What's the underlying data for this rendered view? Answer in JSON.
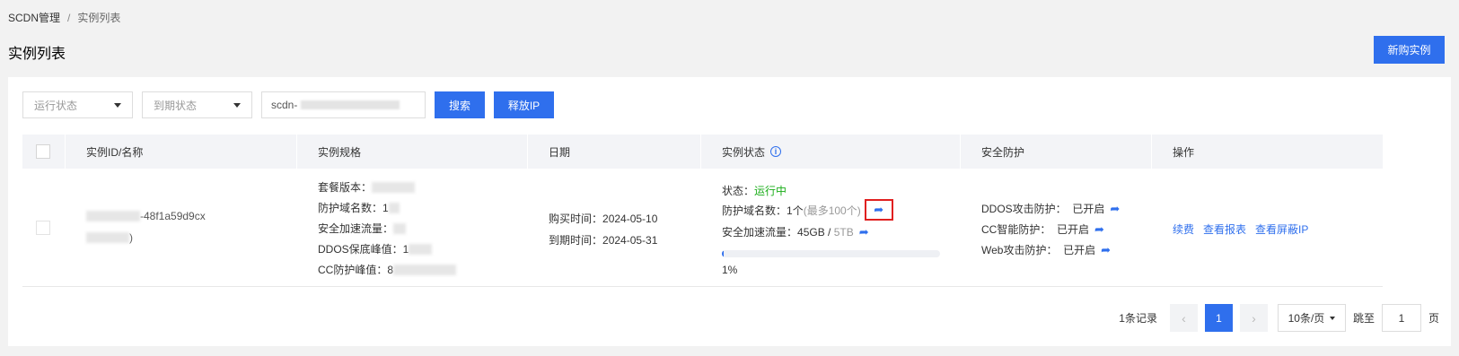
{
  "breadcrumb": {
    "root": "SCDN管理",
    "separator": "/",
    "current": "实例列表"
  },
  "page": {
    "title": "实例列表",
    "buy_button": "新购实例"
  },
  "filters": {
    "run_status_placeholder": "运行状态",
    "expire_status_placeholder": "到期状态",
    "search_value_prefix": "scdn-",
    "search_button": "搜索",
    "release_button": "释放IP"
  },
  "table": {
    "headers": {
      "id": "实例ID/名称",
      "spec": "实例规格",
      "date": "日期",
      "status": "实例状态",
      "security": "安全防护",
      "ops": "操作"
    },
    "rows": [
      {
        "id_suffix": "-48f1a59d9cx",
        "name_suffix": ")",
        "spec": {
          "package": "套餐版本：",
          "domains": "防护域名数：1",
          "traffic": "安全加速流量：",
          "ddos": "DDOS保底峰值：1",
          "cc": "CC防护峰值：8"
        },
        "dates": {
          "purchase_label": "购买时间：",
          "purchase": "2024-05-10",
          "expire_label": "到期时间：",
          "expire": "2024-05-31"
        },
        "status": {
          "state_label": "状态：",
          "state": "运行中",
          "domains_label": "防护域名数：",
          "domains": "1个",
          "domains_max": "(最多100个)",
          "traffic_label": "安全加速流量：",
          "traffic_used": "45GB",
          "traffic_sep": " / ",
          "traffic_total": "5TB",
          "progress_percent": 1,
          "progress_text": "1%"
        },
        "security": {
          "ddos": "DDOS攻击防护：  已开启",
          "cc": "CC智能防护：  已开启",
          "web": "Web攻击防护：  已开启"
        },
        "ops": {
          "renew": "续费",
          "report": "查看报表",
          "blocked_ip": "查看屏蔽IP"
        }
      }
    ]
  },
  "pagination": {
    "total": "1条记录",
    "prev": "‹",
    "current": "1",
    "next": "›",
    "page_size": "10条/页",
    "jump_label": "跳至",
    "jump_value": "1",
    "page_unit": "页"
  },
  "colors": {
    "primary": "#2f6fed",
    "running": "#1aad19",
    "highlight_border": "#e02020"
  },
  "icons": {
    "jump": "share-arrow-icon",
    "info": "info-circle-icon",
    "dropdown": "caret-down-icon"
  }
}
